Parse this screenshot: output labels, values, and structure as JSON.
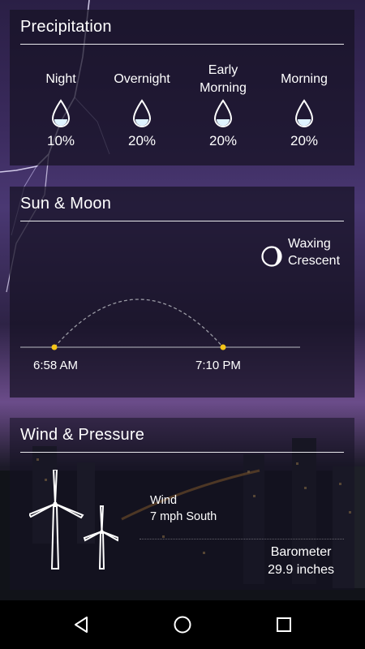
{
  "precipitation": {
    "title": "Precipitation",
    "periods": [
      {
        "label": "Night",
        "value": "10%"
      },
      {
        "label": "Overnight",
        "value": "20%"
      },
      {
        "label": "Early Morning",
        "value": "20%"
      },
      {
        "label": "Morning",
        "value": "20%"
      }
    ]
  },
  "sun_moon": {
    "title": "Sun & Moon",
    "moon_phase_line1": "Waxing",
    "moon_phase_line2": "Crescent",
    "sunrise": "6:58 AM",
    "sunset": "7:10 PM"
  },
  "wind_pressure": {
    "title": "Wind & Pressure",
    "wind_label": "Wind",
    "wind_value": "7 mph South",
    "barometer_label": "Barometer",
    "barometer_value": "29.9 inches"
  },
  "navigation": {
    "back_icon": "back-triangle-icon",
    "home_icon": "home-circle-icon",
    "recents_icon": "recents-square-icon"
  },
  "colors": {
    "sun_dot": "#f5c518",
    "drop_fill": "#dff3ff"
  }
}
